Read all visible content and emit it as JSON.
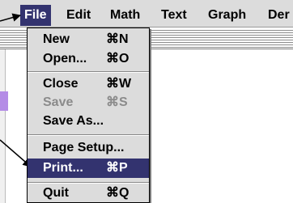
{
  "menubar": {
    "items": [
      {
        "label": "File"
      },
      {
        "label": "Edit"
      },
      {
        "label": "Math"
      },
      {
        "label": "Text"
      },
      {
        "label": "Graph"
      },
      {
        "label": "Der"
      }
    ]
  },
  "file_menu": {
    "items": [
      {
        "label": "New",
        "shortcut": "⌘N"
      },
      {
        "label": "Open...",
        "shortcut": "⌘O"
      },
      {
        "label": "Close",
        "shortcut": "⌘W"
      },
      {
        "label": "Save",
        "shortcut": "⌘S",
        "enabled": false
      },
      {
        "label": "Save As...",
        "shortcut": ""
      },
      {
        "label": "Page Setup...",
        "shortcut": ""
      },
      {
        "label": "Print...",
        "shortcut": "⌘P",
        "highlighted": true
      },
      {
        "label": "Quit",
        "shortcut": "⌘Q"
      }
    ]
  },
  "colors": {
    "highlight": "#33336f",
    "menubar_bg": "#dcdcdc",
    "disabled_text": "#8b8b8b"
  }
}
